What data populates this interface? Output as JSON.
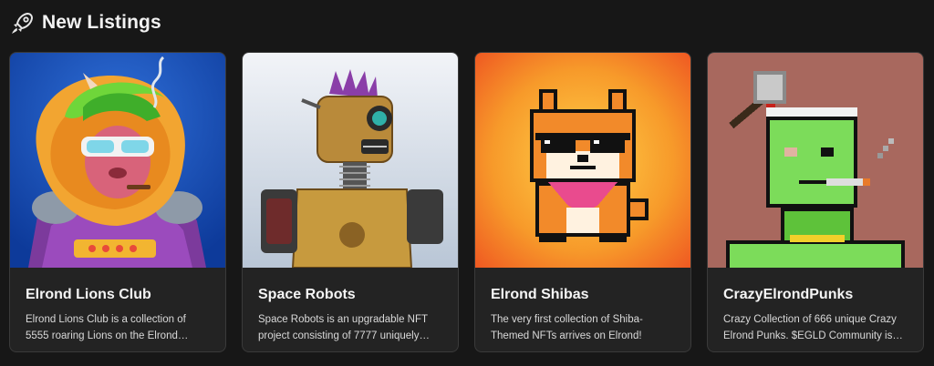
{
  "header": {
    "title": "New Listings",
    "icon": "rocket-icon"
  },
  "listings": [
    {
      "name": "Elrond Lions Club",
      "description": "Elrond Lions Club is a collection of 5555 roaring Lions on the Elrond blockchain.",
      "image": "lion-astronaut-art"
    },
    {
      "name": "Space Robots",
      "description": "Space Robots is an upgradable NFT project consisting of 7777 uniquely designed robots.",
      "image": "rusty-robot-art"
    },
    {
      "name": "Elrond Shibas",
      "description": "The very first collection of Shiba-Themed NFTs arrives on Elrond!",
      "image": "pixel-shiba-art"
    },
    {
      "name": "CrazyElrondPunks",
      "description": "Crazy Collection of 666 unique Crazy Elrond Punks. $EGLD Community is the best community.",
      "image": "pixel-punk-art"
    }
  ]
}
